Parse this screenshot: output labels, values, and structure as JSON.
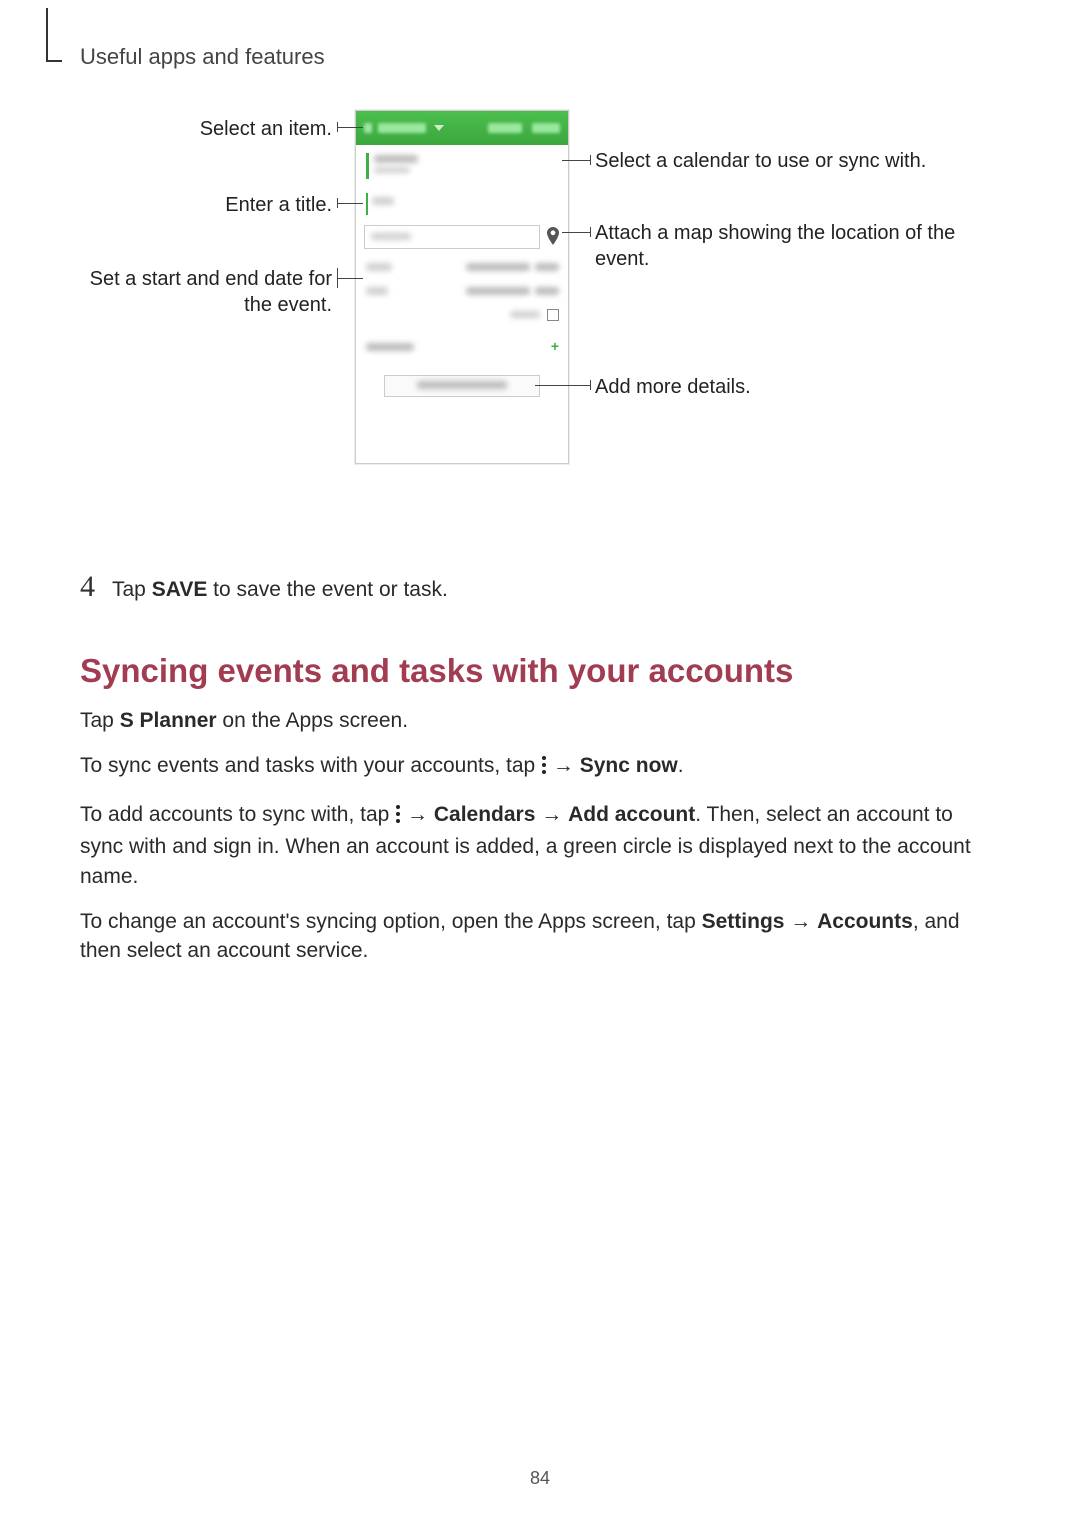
{
  "header": {
    "section_title": "Useful apps and features"
  },
  "callouts": {
    "select_item": "Select an item.",
    "enter_title": "Enter a title.",
    "set_dates": "Set a start and end date for the event.",
    "select_cal": "Select a calendar to use or sync with.",
    "attach_map": "Attach a map showing the location of the event.",
    "add_more": "Add more details."
  },
  "step4": {
    "num": "4",
    "pre": "Tap ",
    "bold": "SAVE",
    "post": " to save the event or task."
  },
  "sync_heading": "Syncing events and tasks with your accounts",
  "p1": {
    "pre": "Tap ",
    "bold": "S Planner",
    "post": " on the Apps screen."
  },
  "p2": {
    "pre": "To sync events and tasks with your accounts, tap ",
    "arrow": " → ",
    "bold": "Sync now",
    "post": "."
  },
  "p3": {
    "pre": "To add accounts to sync with, tap ",
    "arrow1": " → ",
    "b1": "Calendars",
    "arrow2": " → ",
    "b2": "Add account",
    "post": ". Then, select an account to sync with and sign in. When an account is added, a green circle is displayed next to the account name."
  },
  "p4": {
    "pre": "To change an account's syncing option, open the Apps screen, tap ",
    "b1": "Settings",
    "arrow": " → ",
    "b2": "Accounts",
    "post": ", and then select an account service."
  },
  "page_number": "84"
}
